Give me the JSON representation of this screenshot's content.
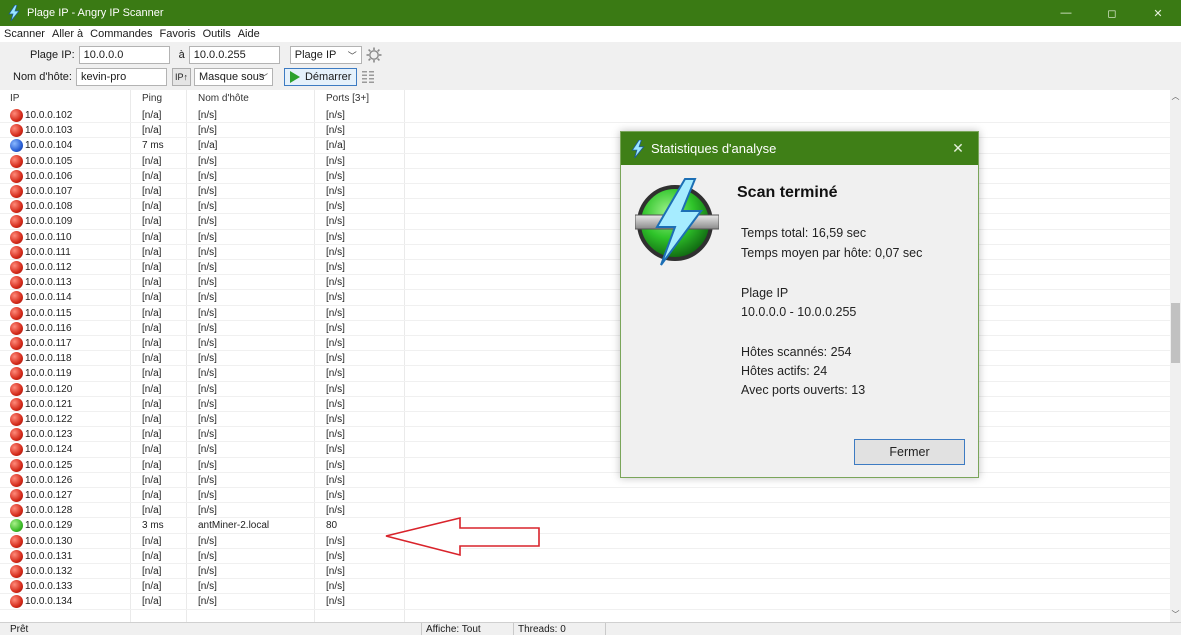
{
  "window": {
    "title": "Plage IP - Angry IP Scanner",
    "controls": [
      "—",
      "◻",
      "✕"
    ]
  },
  "menu": [
    "Scanner",
    "Aller à",
    "Commandes",
    "Favoris",
    "Outils",
    "Aide"
  ],
  "toolbar": {
    "range_label": "Plage IP:",
    "range_start": "10.0.0.0",
    "range_to_label": "à",
    "range_end": "10.0.0.255",
    "mode_select": "Plage IP",
    "hostname_label": "Nom d'hôte:",
    "hostname_value": "kevin-pro",
    "ip_button": "IP↑",
    "mask_select": "Masque sous",
    "start_label": "Démarrer"
  },
  "table": {
    "columns": [
      "IP",
      "Ping",
      "Nom d'hôte",
      "Ports [3+]"
    ],
    "rows": [
      {
        "ip": "10.0.0.102",
        "ping": "[n/a]",
        "host": "[n/s]",
        "ports": "[n/s]",
        "status": "dead"
      },
      {
        "ip": "10.0.0.103",
        "ping": "[n/a]",
        "host": "[n/s]",
        "ports": "[n/s]",
        "status": "dead"
      },
      {
        "ip": "10.0.0.104",
        "ping": "7 ms",
        "host": "[n/a]",
        "ports": "[n/a]",
        "status": "alive"
      },
      {
        "ip": "10.0.0.105",
        "ping": "[n/a]",
        "host": "[n/s]",
        "ports": "[n/s]",
        "status": "dead"
      },
      {
        "ip": "10.0.0.106",
        "ping": "[n/a]",
        "host": "[n/s]",
        "ports": "[n/s]",
        "status": "dead"
      },
      {
        "ip": "10.0.0.107",
        "ping": "[n/a]",
        "host": "[n/s]",
        "ports": "[n/s]",
        "status": "dead"
      },
      {
        "ip": "10.0.0.108",
        "ping": "[n/a]",
        "host": "[n/s]",
        "ports": "[n/s]",
        "status": "dead"
      },
      {
        "ip": "10.0.0.109",
        "ping": "[n/a]",
        "host": "[n/s]",
        "ports": "[n/s]",
        "status": "dead"
      },
      {
        "ip": "10.0.0.110",
        "ping": "[n/a]",
        "host": "[n/s]",
        "ports": "[n/s]",
        "status": "dead"
      },
      {
        "ip": "10.0.0.111",
        "ping": "[n/a]",
        "host": "[n/s]",
        "ports": "[n/s]",
        "status": "dead"
      },
      {
        "ip": "10.0.0.112",
        "ping": "[n/a]",
        "host": "[n/s]",
        "ports": "[n/s]",
        "status": "dead"
      },
      {
        "ip": "10.0.0.113",
        "ping": "[n/a]",
        "host": "[n/s]",
        "ports": "[n/s]",
        "status": "dead"
      },
      {
        "ip": "10.0.0.114",
        "ping": "[n/a]",
        "host": "[n/s]",
        "ports": "[n/s]",
        "status": "dead"
      },
      {
        "ip": "10.0.0.115",
        "ping": "[n/a]",
        "host": "[n/s]",
        "ports": "[n/s]",
        "status": "dead"
      },
      {
        "ip": "10.0.0.116",
        "ping": "[n/a]",
        "host": "[n/s]",
        "ports": "[n/s]",
        "status": "dead"
      },
      {
        "ip": "10.0.0.117",
        "ping": "[n/a]",
        "host": "[n/s]",
        "ports": "[n/s]",
        "status": "dead"
      },
      {
        "ip": "10.0.0.118",
        "ping": "[n/a]",
        "host": "[n/s]",
        "ports": "[n/s]",
        "status": "dead"
      },
      {
        "ip": "10.0.0.119",
        "ping": "[n/a]",
        "host": "[n/s]",
        "ports": "[n/s]",
        "status": "dead"
      },
      {
        "ip": "10.0.0.120",
        "ping": "[n/a]",
        "host": "[n/s]",
        "ports": "[n/s]",
        "status": "dead"
      },
      {
        "ip": "10.0.0.121",
        "ping": "[n/a]",
        "host": "[n/s]",
        "ports": "[n/s]",
        "status": "dead"
      },
      {
        "ip": "10.0.0.122",
        "ping": "[n/a]",
        "host": "[n/s]",
        "ports": "[n/s]",
        "status": "dead"
      },
      {
        "ip": "10.0.0.123",
        "ping": "[n/a]",
        "host": "[n/s]",
        "ports": "[n/s]",
        "status": "dead"
      },
      {
        "ip": "10.0.0.124",
        "ping": "[n/a]",
        "host": "[n/s]",
        "ports": "[n/s]",
        "status": "dead"
      },
      {
        "ip": "10.0.0.125",
        "ping": "[n/a]",
        "host": "[n/s]",
        "ports": "[n/s]",
        "status": "dead"
      },
      {
        "ip": "10.0.0.126",
        "ping": "[n/a]",
        "host": "[n/s]",
        "ports": "[n/s]",
        "status": "dead"
      },
      {
        "ip": "10.0.0.127",
        "ping": "[n/a]",
        "host": "[n/s]",
        "ports": "[n/s]",
        "status": "dead"
      },
      {
        "ip": "10.0.0.128",
        "ping": "[n/a]",
        "host": "[n/s]",
        "ports": "[n/s]",
        "status": "dead"
      },
      {
        "ip": "10.0.0.129",
        "ping": "3 ms",
        "host": "antMiner-2.local",
        "ports": "80",
        "status": "open"
      },
      {
        "ip": "10.0.0.130",
        "ping": "[n/a]",
        "host": "[n/s]",
        "ports": "[n/s]",
        "status": "dead"
      },
      {
        "ip": "10.0.0.131",
        "ping": "[n/a]",
        "host": "[n/s]",
        "ports": "[n/s]",
        "status": "dead"
      },
      {
        "ip": "10.0.0.132",
        "ping": "[n/a]",
        "host": "[n/s]",
        "ports": "[n/s]",
        "status": "dead"
      },
      {
        "ip": "10.0.0.133",
        "ping": "[n/a]",
        "host": "[n/s]",
        "ports": "[n/s]",
        "status": "dead"
      },
      {
        "ip": "10.0.0.134",
        "ping": "[n/a]",
        "host": "[n/s]",
        "ports": "[n/s]",
        "status": "dead"
      }
    ]
  },
  "statusbar": {
    "state": "Prêt",
    "display": "Affiche: Tout",
    "threads": "Threads: 0"
  },
  "dialog": {
    "title": "Statistiques d'analyse",
    "heading": "Scan terminé",
    "total_time": "Temps total: 16,59 sec",
    "avg_time": "Temps moyen par hôte: 0,07 sec",
    "range_label": "Plage IP",
    "range_value": "10.0.0.0 - 10.0.0.255",
    "hosts_scanned": "Hôtes scannés: 254",
    "hosts_alive": "Hôtes actifs: 24",
    "hosts_open": "Avec ports ouverts: 13",
    "close_label": "Fermer",
    "close_icon": "✕"
  },
  "colors": {
    "title_bar": "#3a7a14",
    "dialog_title_bar": "#3f7f17",
    "annotation_arrow": "#d9232b",
    "status_dead": "#d42a1a",
    "status_alive": "#2a5fd4",
    "status_open": "#3dbb2a"
  },
  "icons": {
    "app": "lightning-bolt-icon",
    "settings": "gear-icon",
    "fetchers": "columns-icon",
    "scrollbar_up": "chevron-up-icon",
    "scrollbar_down": "chevron-down-icon"
  }
}
